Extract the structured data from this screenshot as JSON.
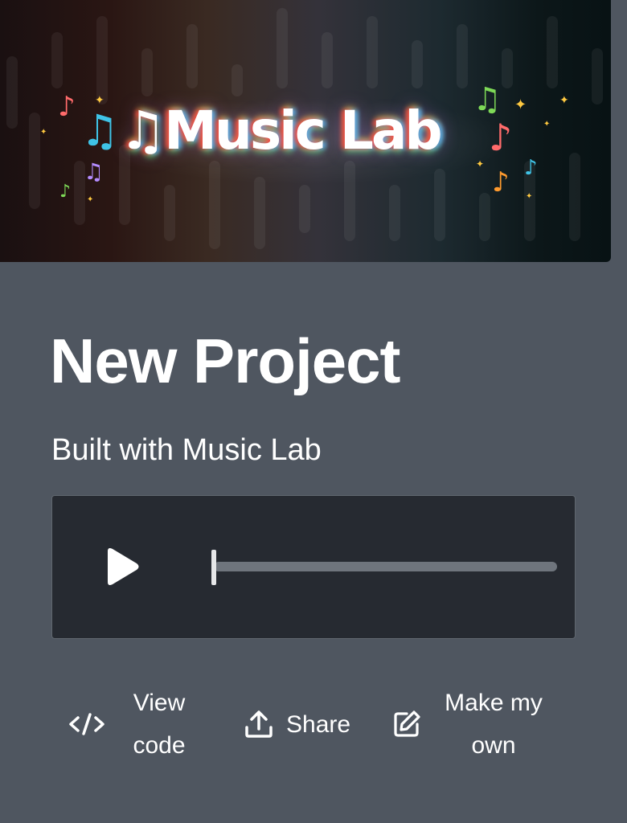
{
  "banner": {
    "title": "♫Music Lab"
  },
  "project": {
    "title": "New Project",
    "subtitle": "Built with Music Lab"
  },
  "player": {
    "progress": 0,
    "icons": {
      "play": "play-icon"
    }
  },
  "actions": [
    {
      "icon": "code-icon",
      "line1": "View",
      "line2": "code"
    },
    {
      "icon": "share-upload-icon",
      "label": "Share"
    },
    {
      "icon": "edit-icon",
      "line1": "Make my",
      "line2": "own"
    }
  ],
  "colors": {
    "panel_bg": "#4f5660",
    "player_bg": "#262a31",
    "track": "#6f757d",
    "text": "#ffffff"
  }
}
